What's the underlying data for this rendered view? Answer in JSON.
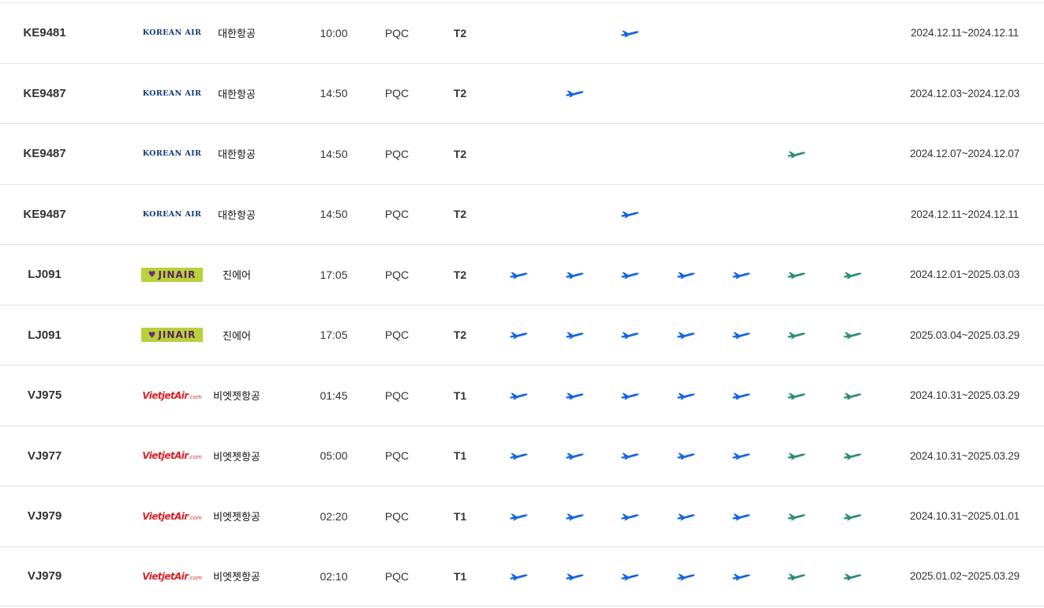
{
  "schedule": {
    "rows": [
      {
        "flight": "KE9481",
        "airline": "korean",
        "airline_name": "대한항공",
        "time": "10:00",
        "destination": "PQC",
        "terminal": "T2",
        "days": [
          0,
          0,
          1,
          0,
          0,
          0,
          0
        ],
        "period": "2024.12.11~2024.12.11"
      },
      {
        "flight": "KE9487",
        "airline": "korean",
        "airline_name": "대한항공",
        "time": "14:50",
        "destination": "PQC",
        "terminal": "T2",
        "days": [
          0,
          1,
          0,
          0,
          0,
          0,
          0
        ],
        "period": "2024.12.03~2024.12.03"
      },
      {
        "flight": "KE9487",
        "airline": "korean",
        "airline_name": "대한항공",
        "time": "14:50",
        "destination": "PQC",
        "terminal": "T2",
        "days": [
          0,
          0,
          0,
          0,
          0,
          1,
          0
        ],
        "period": "2024.12.07~2024.12.07"
      },
      {
        "flight": "KE9487",
        "airline": "korean",
        "airline_name": "대한항공",
        "time": "14:50",
        "destination": "PQC",
        "terminal": "T2",
        "days": [
          0,
          0,
          1,
          0,
          0,
          0,
          0
        ],
        "period": "2024.12.11~2024.12.11"
      },
      {
        "flight": "LJ091",
        "airline": "jinair",
        "airline_name": "진에어",
        "time": "17:05",
        "destination": "PQC",
        "terminal": "T2",
        "days": [
          1,
          1,
          1,
          1,
          1,
          1,
          1
        ],
        "period": "2024.12.01~2025.03.03"
      },
      {
        "flight": "LJ091",
        "airline": "jinair",
        "airline_name": "진에어",
        "time": "17:05",
        "destination": "PQC",
        "terminal": "T2",
        "days": [
          1,
          1,
          1,
          1,
          1,
          1,
          1
        ],
        "period": "2025.03.04~2025.03.29"
      },
      {
        "flight": "VJ975",
        "airline": "vietjet",
        "airline_name": "비엣젯항공",
        "time": "01:45",
        "destination": "PQC",
        "terminal": "T1",
        "days": [
          1,
          1,
          1,
          1,
          1,
          1,
          1
        ],
        "period": "2024.10.31~2025.03.29"
      },
      {
        "flight": "VJ977",
        "airline": "vietjet",
        "airline_name": "비엣젯항공",
        "time": "05:00",
        "destination": "PQC",
        "terminal": "T1",
        "days": [
          1,
          1,
          1,
          1,
          1,
          1,
          1
        ],
        "period": "2024.10.31~2025.03.29"
      },
      {
        "flight": "VJ979",
        "airline": "vietjet",
        "airline_name": "비엣젯항공",
        "time": "02:20",
        "destination": "PQC",
        "terminal": "T1",
        "days": [
          1,
          1,
          1,
          1,
          1,
          1,
          1
        ],
        "period": "2024.10.31~2025.01.01"
      },
      {
        "flight": "VJ979",
        "airline": "vietjet",
        "airline_name": "비엣젯항공",
        "time": "02:10",
        "destination": "PQC",
        "terminal": "T1",
        "days": [
          1,
          1,
          1,
          1,
          1,
          1,
          1
        ],
        "period": "2025.01.02~2025.03.29"
      }
    ]
  },
  "logos": {
    "korean": {
      "text": "KOREAN AIR",
      "color": "#11387a"
    },
    "jinair": {
      "text": "JINAIR",
      "color": "#b9d13a"
    },
    "vietjet": {
      "text": "VietjetAir",
      "suffix": ".com",
      "color": "#d8232a"
    }
  },
  "colors": {
    "weekday_plane": "#1466e0",
    "weekend_plane": "#2d8c7a",
    "row_border": "#e3e3e3"
  },
  "icons": {
    "operating_day": "airplane-icon"
  }
}
